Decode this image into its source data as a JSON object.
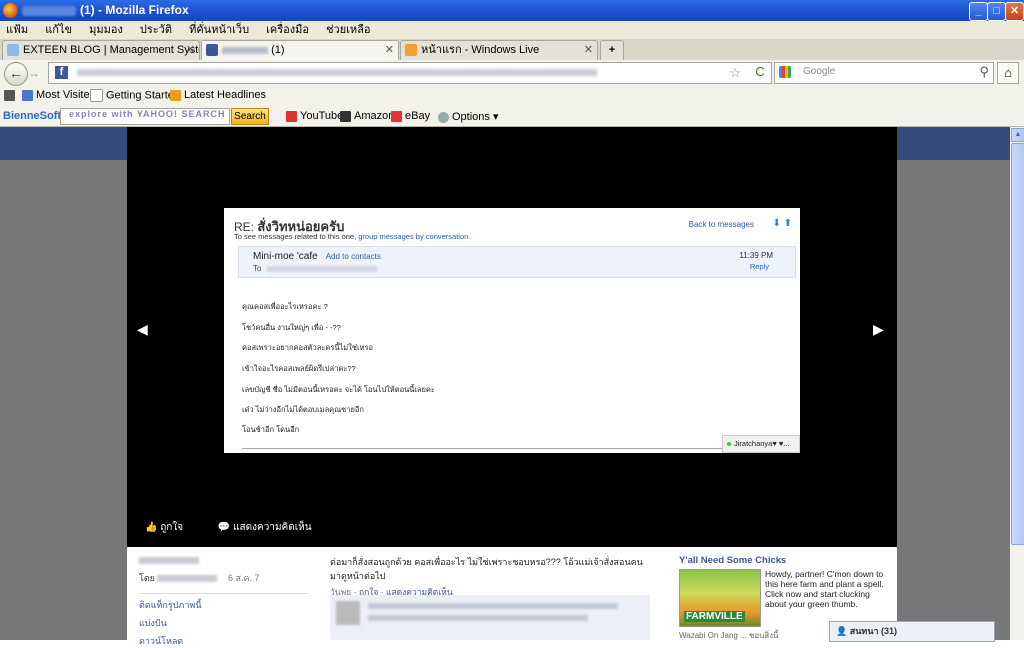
{
  "window": {
    "title": "(1) - Mozilla Firefox",
    "buttons": {
      "minimize": "_",
      "maximize": "□",
      "close": "✕"
    }
  },
  "menu": [
    "แฟ้ม",
    "แก้ไข",
    "มุมมอง",
    "ประวัติ",
    "ที่คั่นหน้าเว็บ",
    "เครื่องมือ",
    "ช่วยเหลือ"
  ],
  "tabs": [
    {
      "label": "EXTEEN BLOG | Management System",
      "close": "✕"
    },
    {
      "label": "(1)",
      "close": "✕"
    },
    {
      "label": "หน้าแรก - Windows Live",
      "close": "✕"
    }
  ],
  "new_tab": "+",
  "nav": {
    "back": "←",
    "forward": "→",
    "reload": "C",
    "star": "☆",
    "search_placeholder": "Google",
    "search_icon": "⚲",
    "home": "⌂"
  },
  "bookmarks": [
    "Most Visited",
    "Getting Started",
    "Latest Headlines"
  ],
  "yahoo_toolbar": {
    "brand": "BienneSoft",
    "search_label": "explore with YAHOO! SEARCH",
    "search_button": "Search",
    "links": [
      "YouTube",
      "Amazon",
      "eBay",
      "Options"
    ]
  },
  "photo": {
    "title_prefix": "RE:",
    "title": "สั่งวิทหน่อยครับ",
    "subtitle": "To see messages related to this one,",
    "subtitle_link": "group messages by conversation.",
    "back_link": "Back to messages",
    "arrows": "⬇ ⬆",
    "from": "Mini-moe 'cafe",
    "add_contacts": "Add to contacts",
    "to_label": "To",
    "time": "11:39 PM",
    "reply": "Reply",
    "lines": [
      "คุณคอสเพื่ออะไรเหรอคะ ?",
      "โชว์คนอื่น งานใหญ่ๆ เพื่อ - -??",
      "คอสเพราะอยากคอสตัวละครนี้ไม่ใช่เหรอ",
      "เข้าใจอะไรคอสเพลย์ผิดรึเปล่าคะ??",
      "เลขบัญชี ชื่อ ไม่มีตอนนี้เหรอคะ จะได้ โอนไปให้ตอนนี้เลยคะ",
      "เด๋ว ไม่ว่างอีกไม่ได้ตอบเมลคุณชายอีก",
      "โอนช้าอีก โดนอีก"
    ],
    "chat_name": "Jiratchanya♥ ♥..."
  },
  "photo_actions": {
    "like": "ถูกใจ",
    "comment": "แสดงความคิดเห็น"
  },
  "sidebar_left": {
    "by": "โดย",
    "date": "6 ส.ค. 7",
    "links": [
      "ติดแท็กรูปภาพนี้",
      "แบ่งปัน",
      "ดาวน์โหลด"
    ]
  },
  "caption": {
    "text": "ต่อมาก็สั่งสอนถูกด้วย คอสเพื่ออะไร ไม่ใช่เพราะชอบหรอ??? โอ้วแม่เจ้าสั่งสอนคน มาดูหน้าต่อไป",
    "meta_prefix": "วันพุธ",
    "meta_like": "ถูกใจ",
    "meta_comment": "แสดงความคิดเห็น"
  },
  "ad": {
    "title": "Y'all Need Some Chicks",
    "image_text": "FARMVILLE",
    "body": "Howdy, partner! C'mon down to this here farm and plant a spell. Click now and start clucking about your green thumb.",
    "by": "Wazabi On Jang ... ชอบสิ่งนี้"
  },
  "chat": {
    "label": "สนทนา (31)"
  },
  "colors": {
    "fb_blue": "#3b5998",
    "titlebar": "#2c6ce6"
  }
}
